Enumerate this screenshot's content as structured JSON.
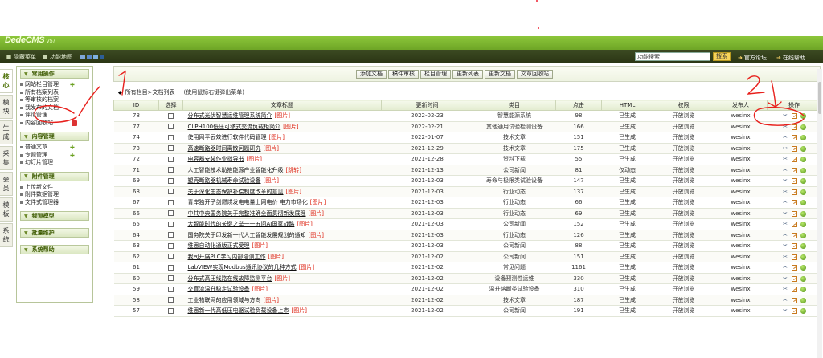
{
  "header": {
    "logo_text": "DedeCMS",
    "logo_version": "V57",
    "nav": [
      "隐藏菜单",
      "功能地图"
    ],
    "swatch_colors": [
      "#7fa7d8",
      "#5a88c7",
      "#7fb2e0",
      "#2d5e98"
    ],
    "search_value": "功能搜索",
    "search_button": "搜索",
    "links": [
      "官方论坛",
      "在线帮助"
    ]
  },
  "vtabs": [
    "核心",
    "模块",
    "生成",
    "采集",
    "会员",
    "模板",
    "系统"
  ],
  "sidebar": {
    "groups": [
      {
        "title": "常用操作",
        "items": [
          "网站栏目管理",
          "所有档案列表",
          "等审核的档案",
          "我发布的文档",
          "评论管理",
          "内容回收站"
        ]
      },
      {
        "title": "内容管理",
        "items": [
          "普通文章",
          "专题管理",
          "幻灯片管理"
        ]
      },
      {
        "title": "附件管理",
        "items": [
          "上传新文件",
          "附件数据管理",
          "文件式管理器"
        ]
      },
      {
        "title": "频道模型",
        "items": []
      },
      {
        "title": "批量维护",
        "items": []
      },
      {
        "title": "系统帮助",
        "items": []
      }
    ]
  },
  "toolbar": {
    "buttons": [
      "添加文档",
      "稿件审核",
      "栏目管理",
      "更新列表",
      "更新文档",
      "文章回收站"
    ]
  },
  "crumb": {
    "path": "所有栏目>文档列表",
    "hint": "(使用鼠标右键弹出菜单)"
  },
  "table": {
    "headers": [
      "ID",
      "选择",
      "文章标题",
      "更新时间",
      "类目",
      "点击",
      "HTML",
      "权限",
      "发布人",
      "操作"
    ],
    "img_tag": "[图片]",
    "rows": [
      {
        "id": "78",
        "title": "分布式光伏智慧运维管理系统简介",
        "img": true,
        "date": "2022-02-23",
        "cat": "智慧能源系统",
        "clicks": "98",
        "html": "已生成",
        "perm": "开放浏览",
        "author": "wesinx"
      },
      {
        "id": "77",
        "title": "CLPH100低压可移式交流负载柜简介",
        "img": true,
        "date": "2022-02-21",
        "cat": "其他通用试验检测设备",
        "clicks": "166",
        "html": "已生成",
        "perm": "开放浏览",
        "author": "wesinx"
      },
      {
        "id": "74",
        "title": "使用网平云效进行软件代码管理",
        "img": true,
        "date": "2022-01-07",
        "cat": "技术文章",
        "clicks": "151",
        "html": "已生成",
        "perm": "开放浏览",
        "author": "wesinx"
      },
      {
        "id": "73",
        "title": "高速断路器时间离散问题研究",
        "img": true,
        "date": "2021-12-29",
        "cat": "技术文章",
        "clicks": "175",
        "html": "已生成",
        "perm": "开放浏览",
        "author": "wesinx"
      },
      {
        "id": "72",
        "title": "电容器安装作业指导书",
        "img": true,
        "date": "2021-12-28",
        "cat": "资料下载",
        "clicks": "55",
        "html": "已生成",
        "perm": "开放浏览",
        "author": "wesinx"
      },
      {
        "id": "71",
        "title": "人工智能技术助推能源产业智能化升级",
        "img": false,
        "tag": "[跳转]",
        "date": "2021-12-13",
        "cat": "公司新闻",
        "clicks": "81",
        "html": "仅动态",
        "perm": "开放浏览",
        "author": "wesinx"
      },
      {
        "id": "69",
        "title": "塑壳断路器机械寿命试验设备",
        "img": true,
        "date": "2021-12-03",
        "cat": "寿命与极限类试验设备",
        "clicks": "147",
        "html": "已生成",
        "perm": "开放浏览",
        "author": "wesinx"
      },
      {
        "id": "68",
        "title": "关于深化生态保护补偿制度改革的意见",
        "img": true,
        "date": "2021-12-03",
        "cat": "行业动态",
        "clicks": "137",
        "html": "已生成",
        "perm": "开放浏览",
        "author": "wesinx"
      },
      {
        "id": "67",
        "title": "青岸独开子剑燃煤发电电量上网电价 电力市场化",
        "img": true,
        "date": "2021-12-03",
        "cat": "行业动态",
        "clicks": "66",
        "html": "已生成",
        "perm": "开放浏览",
        "author": "wesinx"
      },
      {
        "id": "66",
        "title": "中共中央国务院关于完整准确全面贯彻新发展理",
        "img": true,
        "date": "2021-12-03",
        "cat": "行业动态",
        "clicks": "69",
        "html": "已生成",
        "perm": "开放浏览",
        "author": "wesinx"
      },
      {
        "id": "65",
        "title": "大智能时代的关键之举一一五问AI国家战略",
        "img": true,
        "date": "2021-12-03",
        "cat": "公司新闻",
        "clicks": "152",
        "html": "已生成",
        "perm": "开放浏览",
        "author": "wesinx"
      },
      {
        "id": "64",
        "title": "国务院关于印发新一代人工智能发展规划的通知",
        "img": true,
        "date": "2021-12-03",
        "cat": "行业动态",
        "clicks": "126",
        "html": "已生成",
        "perm": "开放浏览",
        "author": "wesinx"
      },
      {
        "id": "63",
        "title": "维思自动化通版正式受理",
        "img": true,
        "date": "2021-12-03",
        "cat": "公司新闻",
        "clicks": "88",
        "html": "已生成",
        "perm": "开放浏览",
        "author": "wesinx"
      },
      {
        "id": "62",
        "title": "我司开展PLC学习内部培训工作",
        "img": true,
        "date": "2021-12-02",
        "cat": "公司新闻",
        "clicks": "151",
        "html": "已生成",
        "perm": "开放浏览",
        "author": "wesinx"
      },
      {
        "id": "61",
        "title": "LabVIEW实现Modbus通讯协议的几种方式",
        "img": true,
        "date": "2021-12-02",
        "cat": "常见问题",
        "clicks": "1161",
        "html": "已生成",
        "perm": "开放浏览",
        "author": "wesinx"
      },
      {
        "id": "60",
        "title": "分布式高压线路在线故障监测平台",
        "img": true,
        "date": "2021-12-02",
        "cat": "设备预测性运维",
        "clicks": "330",
        "html": "已生成",
        "perm": "开放浏览",
        "author": "wesinx"
      },
      {
        "id": "59",
        "title": "交直流温升稳定试验设备",
        "img": true,
        "date": "2021-12-02",
        "cat": "温升熔断类试验设备",
        "clicks": "310",
        "html": "已生成",
        "perm": "开放浏览",
        "author": "wesinx"
      },
      {
        "id": "58",
        "title": "工业物联网的应用领域与方向",
        "img": true,
        "date": "2021-12-02",
        "cat": "技术文章",
        "clicks": "187",
        "html": "已生成",
        "perm": "开放浏览",
        "author": "wesinx"
      },
      {
        "id": "57",
        "title": "维思新一代高低压电器试验负载设备上市",
        "img": true,
        "date": "2021-12-02",
        "cat": "公司新闻",
        "clicks": "191",
        "html": "已生成",
        "perm": "开放浏览",
        "author": "wesinx"
      }
    ]
  },
  "annotations": {
    "label_left": "1",
    "label_right": "2",
    "color": "#e8201c"
  }
}
